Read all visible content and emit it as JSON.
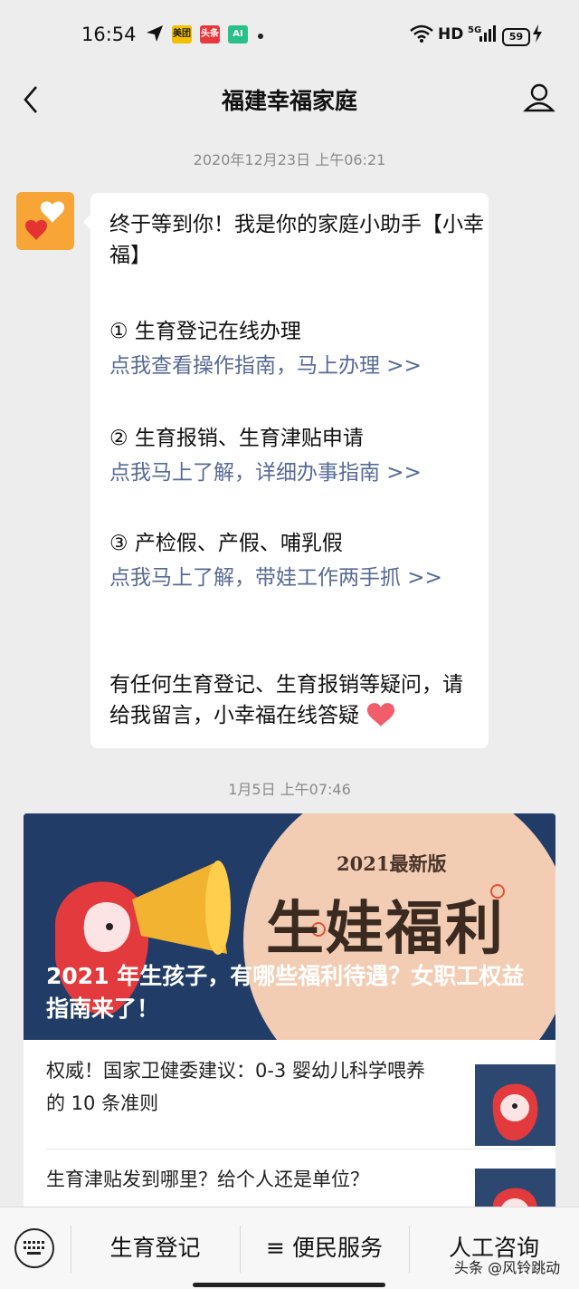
{
  "status": {
    "time": "16:54",
    "network": "HD",
    "signal": "5G",
    "battery": "59",
    "apps": [
      "美团",
      "头条",
      "AI"
    ]
  },
  "header": {
    "title": "福建幸福家庭"
  },
  "messages": {
    "ts1": "2020年12月23日 上午06:21",
    "greet": "终于等到你！我是你的家庭小助手【小幸福】",
    "item1": "① 生育登记在线办理",
    "link1": "点我查看操作指南，马上办理 >>",
    "item2": "② 生育报销、生育津贴申请",
    "link2": "点我马上了解，详细办事指南 >>",
    "item3": "③ 产检假、产假、哺乳假",
    "link3": "点我马上了解，带娃工作两手抓 >>",
    "closing": "有任何生育登记、生育报销等疑问，请给我留言，小幸福在线答疑",
    "ts2": "1月5日 上午07:46"
  },
  "article": {
    "badge": "2021最新版",
    "banner": "生娃福利",
    "title": "2021 年生孩子，有哪些福利待遇？女职工权益指南来了！",
    "items": [
      "权威！国家卫健委建议：0-3 婴幼儿科学喂养的 10 条准则",
      "生育津贴发到哪里？给个人还是单位？"
    ]
  },
  "menu": {
    "items": [
      "生育登记",
      "≡ 便民服务",
      "人工咨询"
    ]
  },
  "watermark": "头条 @风铃跳动"
}
